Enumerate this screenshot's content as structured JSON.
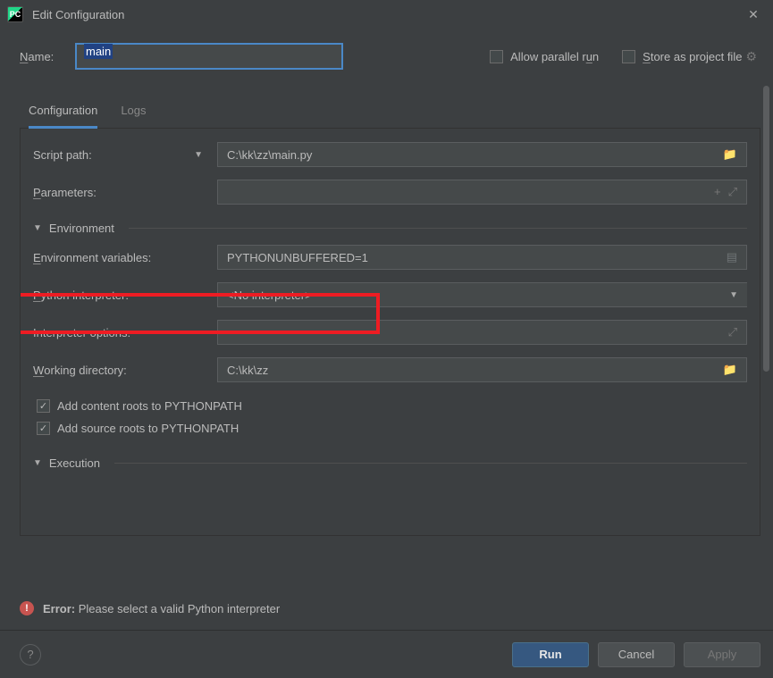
{
  "window": {
    "title": "Edit Configuration"
  },
  "name": {
    "label": "Name:",
    "value": "main"
  },
  "options": {
    "allow_parallel": "Allow parallel run",
    "store_project": "Store as project file"
  },
  "tabs": {
    "config": "Configuration",
    "logs": "Logs"
  },
  "fields": {
    "script_path_label": "Script path:",
    "script_path_value": "C:\\kk\\zz\\main.py",
    "parameters_label": "Parameters:",
    "parameters_value": "",
    "env_section": "Environment",
    "env_vars_label": "Environment variables:",
    "env_vars_value": "PYTHONUNBUFFERED=1",
    "interpreter_label": "Python interpreter:",
    "interpreter_value": "<No interpreter>",
    "interp_opts_label": "Interpreter options:",
    "interp_opts_value": "",
    "workdir_label": "Working directory:",
    "workdir_value": "C:\\kk\\zz",
    "add_content_roots": "Add content roots to PYTHONPATH",
    "add_source_roots": "Add source roots to PYTHONPATH",
    "exec_section": "Execution"
  },
  "error": {
    "prefix": "Error:",
    "message": " Please select a valid Python interpreter"
  },
  "buttons": {
    "run": "Run",
    "cancel": "Cancel",
    "apply": "Apply"
  }
}
